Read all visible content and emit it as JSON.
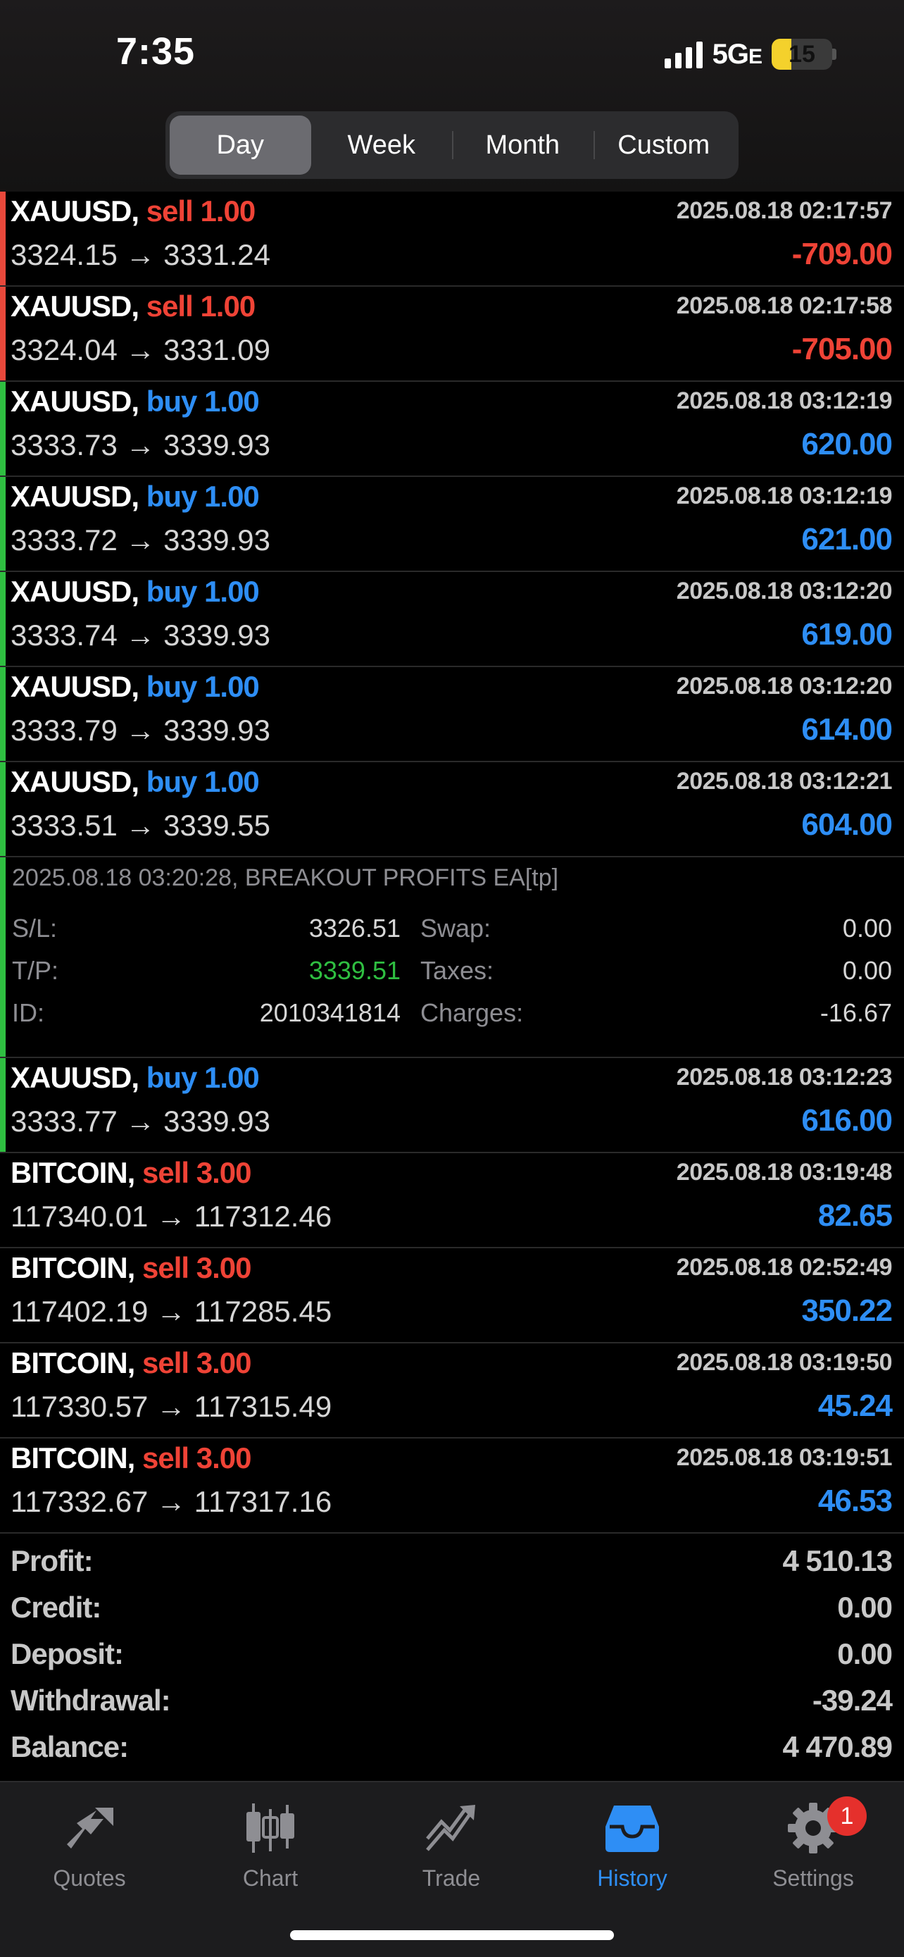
{
  "status": {
    "time": "7:35",
    "network": "5G",
    "network_suffix": "E",
    "battery": "15"
  },
  "period_tabs": [
    {
      "label": "Day",
      "active": true
    },
    {
      "label": "Week",
      "active": false
    },
    {
      "label": "Month",
      "active": false
    },
    {
      "label": "Custom",
      "active": false
    }
  ],
  "deals": [
    {
      "symbol": "XAUUSD,",
      "side": "sell",
      "volume": "1.00",
      "prices": "3324.15 → 3331.24",
      "datetime": "2025.08.18 02:17:57",
      "profit": "-709.00",
      "bar": "red"
    },
    {
      "symbol": "XAUUSD,",
      "side": "sell",
      "volume": "1.00",
      "prices": "3324.04 → 3331.09",
      "datetime": "2025.08.18 02:17:58",
      "profit": "-705.00",
      "bar": "red"
    },
    {
      "symbol": "XAUUSD,",
      "side": "buy",
      "volume": "1.00",
      "prices": "3333.73 → 3339.93",
      "datetime": "2025.08.18 03:12:19",
      "profit": "620.00",
      "bar": "green"
    },
    {
      "symbol": "XAUUSD,",
      "side": "buy",
      "volume": "1.00",
      "prices": "3333.72 → 3339.93",
      "datetime": "2025.08.18 03:12:19",
      "profit": "621.00",
      "bar": "green"
    },
    {
      "symbol": "XAUUSD,",
      "side": "buy",
      "volume": "1.00",
      "prices": "3333.74 → 3339.93",
      "datetime": "2025.08.18 03:12:20",
      "profit": "619.00",
      "bar": "green"
    },
    {
      "symbol": "XAUUSD,",
      "side": "buy",
      "volume": "1.00",
      "prices": "3333.79 → 3339.93",
      "datetime": "2025.08.18 03:12:20",
      "profit": "614.00",
      "bar": "green"
    },
    {
      "symbol": "XAUUSD,",
      "side": "buy",
      "volume": "1.00",
      "prices": "3333.51 → 3339.55",
      "datetime": "2025.08.18 03:12:21",
      "profit": "604.00",
      "bar": "green"
    },
    {
      "symbol": "XAUUSD,",
      "side": "buy",
      "volume": "1.00",
      "prices": "3333.77 → 3339.93",
      "datetime": "2025.08.18 03:12:23",
      "profit": "616.00",
      "bar": "green"
    },
    {
      "symbol": "BITCOIN,",
      "side": "sell",
      "volume": "3.00",
      "prices": "117340.01 → 117312.46",
      "datetime": "2025.08.18 03:19:48",
      "profit": "82.65",
      "bar": "none"
    },
    {
      "symbol": "BITCOIN,",
      "side": "sell",
      "volume": "3.00",
      "prices": "117402.19 → 117285.45",
      "datetime": "2025.08.18 02:52:49",
      "profit": "350.22",
      "bar": "none"
    },
    {
      "symbol": "BITCOIN,",
      "side": "sell",
      "volume": "3.00",
      "prices": "117330.57 → 117315.49",
      "datetime": "2025.08.18 03:19:50",
      "profit": "45.24",
      "bar": "none"
    },
    {
      "symbol": "BITCOIN,",
      "side": "sell",
      "volume": "3.00",
      "prices": "117332.67 → 117317.16",
      "datetime": "2025.08.18 03:19:51",
      "profit": "46.53",
      "bar": "none"
    }
  ],
  "expanded_detail": {
    "comment": "2025.08.18 03:20:28, BREAKOUT PROFITS EA[tp]",
    "sl_label": "S/L:",
    "sl": "3326.51",
    "tp_label": "T/P:",
    "tp": "3339.51",
    "id_label": "ID:",
    "id": "2010341814",
    "swap_label": "Swap:",
    "swap": "0.00",
    "taxes_label": "Taxes:",
    "taxes": "0.00",
    "charges_label": "Charges:",
    "charges": "-16.67"
  },
  "summary": [
    {
      "label": "Profit:",
      "value": "4 510.13"
    },
    {
      "label": "Credit:",
      "value": "0.00"
    },
    {
      "label": "Deposit:",
      "value": "0.00"
    },
    {
      "label": "Withdrawal:",
      "value": "-39.24"
    },
    {
      "label": "Balance:",
      "value": "4 470.89"
    }
  ],
  "tabbar": [
    {
      "label": "Quotes",
      "icon": "quotes-icon",
      "active": false
    },
    {
      "label": "Chart",
      "icon": "chart-icon",
      "active": false
    },
    {
      "label": "Trade",
      "icon": "trade-icon",
      "active": false
    },
    {
      "label": "History",
      "icon": "history-icon",
      "active": true
    },
    {
      "label": "Settings",
      "icon": "gear-icon",
      "active": false,
      "badge": "1"
    }
  ],
  "colors": {
    "sell": "#ef4336",
    "buy": "#2e8ef5",
    "take_profit": "#2fbf41",
    "active_tab": "#2e8ef5",
    "inactive_tab": "#8e8e93"
  }
}
